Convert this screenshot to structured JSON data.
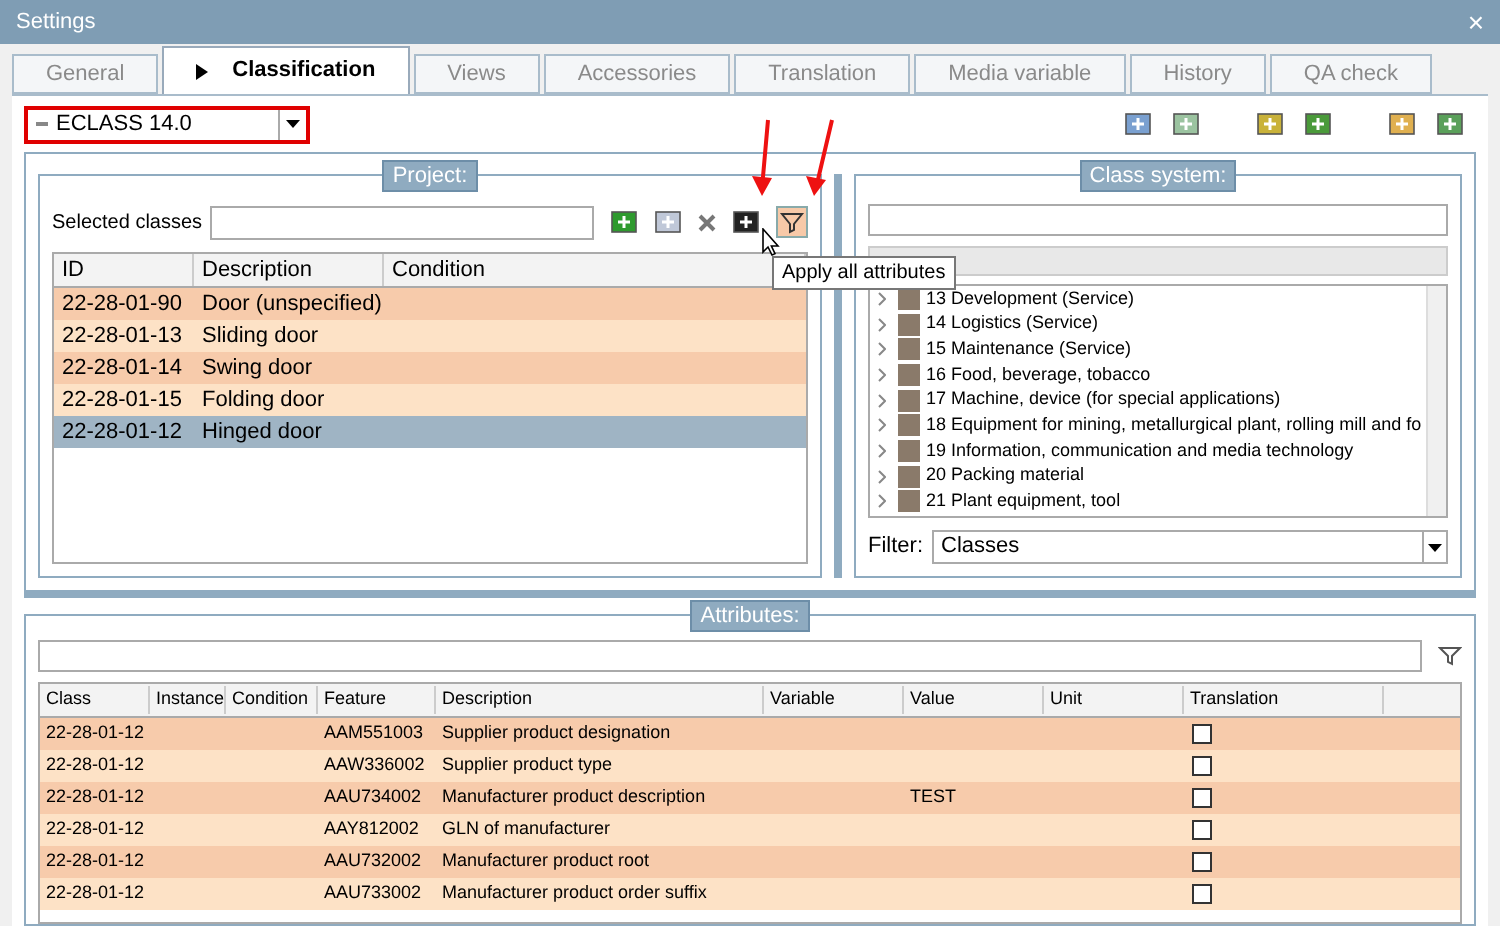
{
  "window": {
    "title": "Settings",
    "close": "×"
  },
  "tabs": [
    {
      "label": "General",
      "selected": false
    },
    {
      "label": "Classification",
      "selected": true
    },
    {
      "label": "Views",
      "selected": false
    },
    {
      "label": "Accessories",
      "selected": false
    },
    {
      "label": "Translation",
      "selected": false
    },
    {
      "label": "Media variable",
      "selected": false
    },
    {
      "label": "History",
      "selected": false
    },
    {
      "label": "QA check",
      "selected": false
    }
  ],
  "standard_select": {
    "value": "ECLASS 14.0"
  },
  "project": {
    "title": "Project:",
    "selected_classes_label": "Selected classes",
    "tooltip": "Apply all attributes",
    "columns": [
      "ID",
      "Description",
      "Condition"
    ],
    "rows": [
      {
        "id": "22-28-01-90",
        "description": "Door (unspecified)",
        "selected": false
      },
      {
        "id": "22-28-01-13",
        "description": "Sliding door",
        "selected": false
      },
      {
        "id": "22-28-01-14",
        "description": "Swing door",
        "selected": false
      },
      {
        "id": "22-28-01-15",
        "description": "Folding door",
        "selected": false
      },
      {
        "id": "22-28-01-12",
        "description": "Hinged door",
        "selected": true
      }
    ]
  },
  "class_system": {
    "title": "Class system:",
    "tree": [
      {
        "label": "13 Development (Service)"
      },
      {
        "label": "14 Logistics (Service)"
      },
      {
        "label": "15 Maintenance (Service)"
      },
      {
        "label": "16 Food, beverage, tobacco"
      },
      {
        "label": "17 Machine, device (for special applications)"
      },
      {
        "label": "18 Equipment for mining, metallurgical plant, rolling mill and fo"
      },
      {
        "label": "19 Information, communication and media technology"
      },
      {
        "label": "20 Packing material"
      },
      {
        "label": "21 Plant equipment, tool"
      }
    ],
    "filter_label": "Filter:",
    "filter_value": "Classes"
  },
  "attributes": {
    "title": "Attributes:",
    "columns": [
      "Class",
      "Instance",
      "Condition",
      "Feature",
      "Description",
      "Variable",
      "Value",
      "Unit",
      "Translation"
    ],
    "rows": [
      {
        "class": "22-28-01-12",
        "feature": "AAM551003",
        "description": "Supplier product designation",
        "value": "",
        "translation": false
      },
      {
        "class": "22-28-01-12",
        "feature": "AAW336002",
        "description": "Supplier product type",
        "value": "",
        "translation": false
      },
      {
        "class": "22-28-01-12",
        "feature": "AAU734002",
        "description": "Manufacturer product description",
        "value": "TEST",
        "translation": false
      },
      {
        "class": "22-28-01-12",
        "feature": "AAY812002",
        "description": "GLN of manufacturer",
        "value": "",
        "translation": false
      },
      {
        "class": "22-28-01-12",
        "feature": "AAU732002",
        "description": "Manufacturer product root",
        "value": "",
        "translation": false
      },
      {
        "class": "22-28-01-12",
        "feature": "AAU733002",
        "description": "Manufacturer product order suffix",
        "value": "",
        "translation": false
      }
    ]
  }
}
